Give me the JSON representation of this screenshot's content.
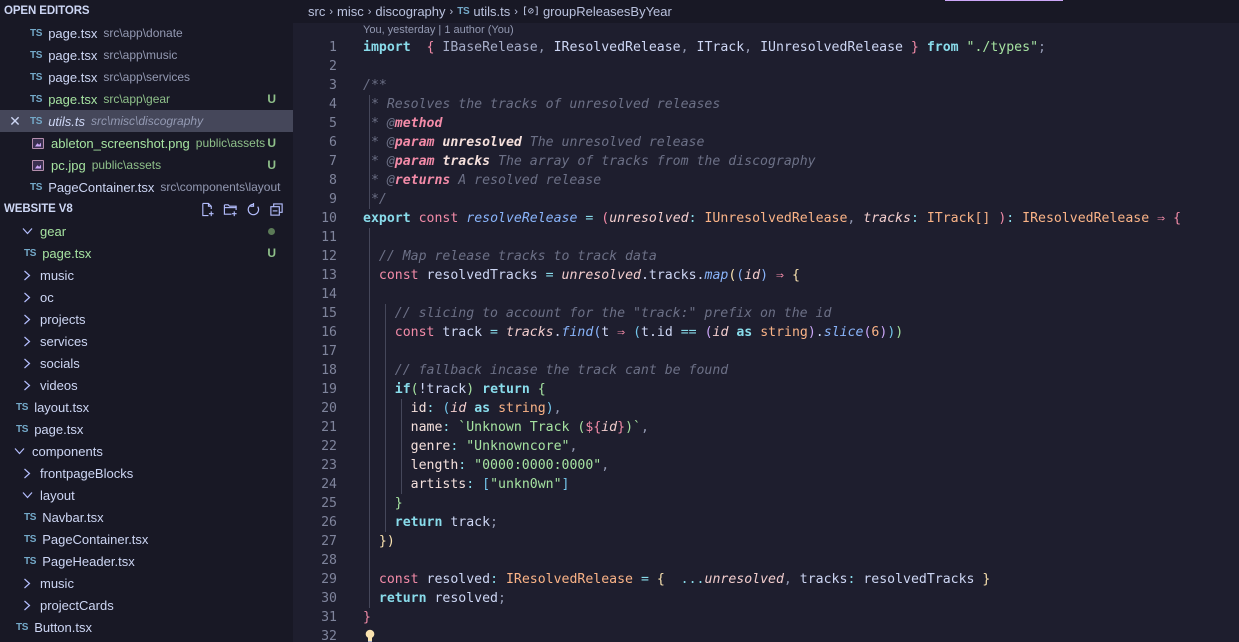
{
  "sidebar": {
    "open_editors_title": "OPEN EDITORS",
    "open_editors": [
      {
        "icon": "ts",
        "name": "page.tsx",
        "desc": "src\\app\\donate",
        "badge": "",
        "green": false,
        "active": false
      },
      {
        "icon": "ts",
        "name": "page.tsx",
        "desc": "src\\app\\music",
        "badge": "",
        "green": false,
        "active": false
      },
      {
        "icon": "ts",
        "name": "page.tsx",
        "desc": "src\\app\\services",
        "badge": "",
        "green": false,
        "active": false
      },
      {
        "icon": "ts",
        "name": "page.tsx",
        "desc": "src\\app\\gear",
        "badge": "U",
        "green": true,
        "active": false
      },
      {
        "icon": "ts",
        "name": "utils.ts",
        "desc": "src\\misc\\discography",
        "badge": "",
        "green": false,
        "active": true
      },
      {
        "icon": "image",
        "name": "ableton_screenshot.png",
        "desc": "public\\assets",
        "badge": "U",
        "green": true,
        "active": false
      },
      {
        "icon": "image",
        "name": "pc.jpg",
        "desc": "public\\assets",
        "badge": "U",
        "green": true,
        "active": false
      },
      {
        "icon": "ts",
        "name": "PageContainer.tsx",
        "desc": "src\\components\\layout",
        "badge": "",
        "green": false,
        "active": false
      }
    ],
    "ts_label": "TS",
    "close_glyph": "✕",
    "workspace_title": "WEBSITE V8",
    "tree": [
      {
        "type": "folder-open",
        "name": "gear",
        "depth": 1,
        "green": true,
        "dot": true
      },
      {
        "type": "file",
        "name": "page.tsx",
        "depth": 2,
        "green": true,
        "badge": "U"
      },
      {
        "type": "folder",
        "name": "music",
        "depth": 1
      },
      {
        "type": "folder",
        "name": "oc",
        "depth": 1
      },
      {
        "type": "folder",
        "name": "projects",
        "depth": 1
      },
      {
        "type": "folder",
        "name": "services",
        "depth": 1
      },
      {
        "type": "folder",
        "name": "socials",
        "depth": 1
      },
      {
        "type": "folder",
        "name": "videos",
        "depth": 1
      },
      {
        "type": "file",
        "name": "layout.tsx",
        "depth": 1
      },
      {
        "type": "file",
        "name": "page.tsx",
        "depth": 1
      },
      {
        "type": "folder-open",
        "name": "components",
        "depth": 0
      },
      {
        "type": "folder",
        "name": "frontpageBlocks",
        "depth": 1
      },
      {
        "type": "folder-open",
        "name": "layout",
        "depth": 1
      },
      {
        "type": "file",
        "name": "Navbar.tsx",
        "depth": 2
      },
      {
        "type": "file",
        "name": "PageContainer.tsx",
        "depth": 2
      },
      {
        "type": "file",
        "name": "PageHeader.tsx",
        "depth": 2
      },
      {
        "type": "folder",
        "name": "music",
        "depth": 1
      },
      {
        "type": "folder",
        "name": "projectCards",
        "depth": 1
      },
      {
        "type": "file",
        "name": "Button.tsx",
        "depth": 1
      }
    ]
  },
  "editor": {
    "breadcrumb": {
      "parts": [
        "src",
        "misc",
        "discography"
      ],
      "file": "utils.ts",
      "symbol_glyph": "[⊘]",
      "symbol": "groupReleasesByYear"
    },
    "blame": "You, yesterday | 1 author (You)",
    "line_numbers": [
      "1",
      "2",
      "3",
      "4",
      "5",
      "6",
      "7",
      "8",
      "9",
      "10",
      "11",
      "12",
      "13",
      "14",
      "15",
      "16",
      "17",
      "18",
      "19",
      "20",
      "21",
      "22",
      "23",
      "24",
      "25",
      "26",
      "27",
      "28",
      "29",
      "30",
      "31",
      "32"
    ],
    "lines": [
      [
        [
          "kw",
          "import"
        ],
        [
          "",
          "  "
        ],
        [
          "b1",
          "{"
        ],
        [
          "dim",
          " IBaseRelease"
        ],
        [
          "pu",
          ", "
        ],
        [
          "",
          "IResolvedRelease"
        ],
        [
          "pu",
          ", "
        ],
        [
          "",
          "ITrack"
        ],
        [
          "pu",
          ", "
        ],
        [
          "",
          "IUnresolvedRelease "
        ],
        [
          "b1",
          "}"
        ],
        [
          "",
          " "
        ],
        [
          "kw",
          "from"
        ],
        [
          "",
          " "
        ],
        [
          "str",
          "\"./types\""
        ],
        [
          "pu",
          ";"
        ]
      ],
      [],
      [
        [
          "cm",
          "/**"
        ]
      ],
      [
        [
          "cm",
          " * Resolves the tracks of unresolved releases"
        ]
      ],
      [
        [
          "cm",
          " * @"
        ],
        [
          "tag",
          "method"
        ]
      ],
      [
        [
          "cm",
          " * @"
        ],
        [
          "tag",
          "param"
        ],
        [
          "",
          " "
        ],
        [
          "prm",
          "unresolved"
        ],
        [
          "cm",
          " The unresolved release"
        ]
      ],
      [
        [
          "cm",
          " * @"
        ],
        [
          "tag",
          "param"
        ],
        [
          "",
          " "
        ],
        [
          "prm",
          "tracks"
        ],
        [
          "cm",
          " The array of tracks from the discography"
        ]
      ],
      [
        [
          "cm",
          " * @"
        ],
        [
          "tag",
          "returns"
        ],
        [
          "cm",
          " A resolved release"
        ]
      ],
      [
        [
          "cm",
          " */"
        ]
      ],
      [
        [
          "kw",
          "export"
        ],
        [
          "",
          " "
        ],
        [
          "kw2",
          "const"
        ],
        [
          "",
          " "
        ],
        [
          "fn",
          "resolveRelease"
        ],
        [
          "op",
          " = "
        ],
        [
          "b1",
          "("
        ],
        [
          "pa",
          "unresolved"
        ],
        [
          "op",
          ": "
        ],
        [
          "ty",
          "IUnresolvedRelease"
        ],
        [
          "pu",
          ", "
        ],
        [
          "pa",
          "tracks"
        ],
        [
          "op",
          ": "
        ],
        [
          "ty",
          "ITrack[]"
        ],
        [
          "",
          " "
        ],
        [
          "b1",
          ")"
        ],
        [
          "op",
          ": "
        ],
        [
          "ty",
          "IResolvedRelease"
        ],
        [
          "",
          " "
        ],
        [
          "ar",
          "⇒"
        ],
        [
          "",
          " "
        ],
        [
          "b1",
          "{"
        ]
      ],
      [],
      [
        [
          "",
          "  "
        ],
        [
          "cm",
          "// Map release tracks to track data"
        ]
      ],
      [
        [
          "",
          "  "
        ],
        [
          "kw2",
          "const"
        ],
        [
          "",
          " resolvedTracks "
        ],
        [
          "op",
          "="
        ],
        [
          "",
          " "
        ],
        [
          "pa",
          "unresolved"
        ],
        [
          "",
          "."
        ],
        [
          "",
          "tracks"
        ],
        [
          "",
          "."
        ],
        [
          "fn",
          "map"
        ],
        [
          "b2",
          "("
        ],
        [
          "b3",
          "("
        ],
        [
          "pa",
          "id"
        ],
        [
          "b3",
          ")"
        ],
        [
          "",
          " "
        ],
        [
          "ar",
          "⇒"
        ],
        [
          "",
          " "
        ],
        [
          "b2",
          "{"
        ]
      ],
      [],
      [
        [
          "",
          "    "
        ],
        [
          "cm",
          "// slicing to account for the \"track:\" prefix on the id"
        ]
      ],
      [
        [
          "",
          "    "
        ],
        [
          "kw2",
          "const"
        ],
        [
          "",
          " track "
        ],
        [
          "op",
          "="
        ],
        [
          "",
          " "
        ],
        [
          "pa",
          "tracks"
        ],
        [
          "",
          "."
        ],
        [
          "fn",
          "find"
        ],
        [
          "b3",
          "("
        ],
        [
          "",
          "t "
        ],
        [
          "ar",
          "⇒"
        ],
        [
          "",
          " "
        ],
        [
          "b6",
          "("
        ],
        [
          "",
          "t.id "
        ],
        [
          "op",
          "=="
        ],
        [
          "",
          " "
        ],
        [
          "b5",
          "("
        ],
        [
          "pa",
          "id"
        ],
        [
          "",
          " "
        ],
        [
          "kw",
          "as"
        ],
        [
          "",
          " "
        ],
        [
          "ty",
          "string"
        ],
        [
          "b5",
          ")"
        ],
        [
          "",
          "."
        ],
        [
          "fn",
          "slice"
        ],
        [
          "b5",
          "("
        ],
        [
          "num",
          "6"
        ],
        [
          "b5",
          ")"
        ],
        [
          "b6",
          ")"
        ],
        [
          "b4",
          ")"
        ]
      ],
      [],
      [
        [
          "",
          "    "
        ],
        [
          "cm",
          "// fallback incase the track cant be found"
        ]
      ],
      [
        [
          "",
          "    "
        ],
        [
          "kw",
          "if"
        ],
        [
          "b4",
          "("
        ],
        [
          "",
          "!track"
        ],
        [
          "b4",
          ")"
        ],
        [
          "",
          " "
        ],
        [
          "kw",
          "return"
        ],
        [
          "",
          " "
        ],
        [
          "b4",
          "{"
        ]
      ],
      [
        [
          "",
          "      "
        ],
        [
          "pr",
          "id"
        ],
        [
          "op",
          ": "
        ],
        [
          "b6",
          "("
        ],
        [
          "pa",
          "id"
        ],
        [
          "",
          " "
        ],
        [
          "kw",
          "as"
        ],
        [
          "",
          " "
        ],
        [
          "ty",
          "string"
        ],
        [
          "b6",
          ")"
        ],
        [
          "pu",
          ","
        ]
      ],
      [
        [
          "",
          "      "
        ],
        [
          "pr",
          "name"
        ],
        [
          "op",
          ": "
        ],
        [
          "str",
          "`Unknown Track ("
        ],
        [
          "b1",
          "${"
        ],
        [
          "pa",
          "id"
        ],
        [
          "b1",
          "}"
        ],
        [
          "str",
          ")`"
        ],
        [
          "pu",
          ","
        ]
      ],
      [
        [
          "",
          "      "
        ],
        [
          "pr",
          "genre"
        ],
        [
          "op",
          ": "
        ],
        [
          "str",
          "\"Unknowncore\""
        ],
        [
          "pu",
          ","
        ]
      ],
      [
        [
          "",
          "      "
        ],
        [
          "pr",
          "length"
        ],
        [
          "op",
          ": "
        ],
        [
          "str",
          "\"0000:0000:0000\""
        ],
        [
          "pu",
          ","
        ]
      ],
      [
        [
          "",
          "      "
        ],
        [
          "pr",
          "artists"
        ],
        [
          "op",
          ": "
        ],
        [
          "b6",
          "["
        ],
        [
          "str",
          "\"unkn0wn\""
        ],
        [
          "b6",
          "]"
        ]
      ],
      [
        [
          "",
          "    "
        ],
        [
          "b4",
          "}"
        ]
      ],
      [
        [
          "",
          "    "
        ],
        [
          "kw",
          "return"
        ],
        [
          "",
          " track"
        ],
        [
          "pu",
          ";"
        ]
      ],
      [
        [
          "",
          "  "
        ],
        [
          "b2",
          "}"
        ],
        [
          "b2",
          ")"
        ]
      ],
      [],
      [
        [
          "",
          "  "
        ],
        [
          "kw2",
          "const"
        ],
        [
          "",
          " resolved"
        ],
        [
          "op",
          ": "
        ],
        [
          "ty",
          "IResolvedRelease"
        ],
        [
          "op",
          " = "
        ],
        [
          "b2",
          "{"
        ],
        [
          "",
          "  "
        ],
        [
          "op",
          "..."
        ],
        [
          "pa",
          "unresolved"
        ],
        [
          "pu",
          ", "
        ],
        [
          "",
          "tracks"
        ],
        [
          "op",
          ": "
        ],
        [
          "",
          "resolvedTracks "
        ],
        [
          "b2",
          "}"
        ]
      ],
      [
        [
          "",
          "  "
        ],
        [
          "kw",
          "return"
        ],
        [
          "",
          " resolved"
        ],
        [
          "pu",
          ";"
        ]
      ],
      [
        [
          "b1",
          "}"
        ]
      ],
      []
    ]
  }
}
